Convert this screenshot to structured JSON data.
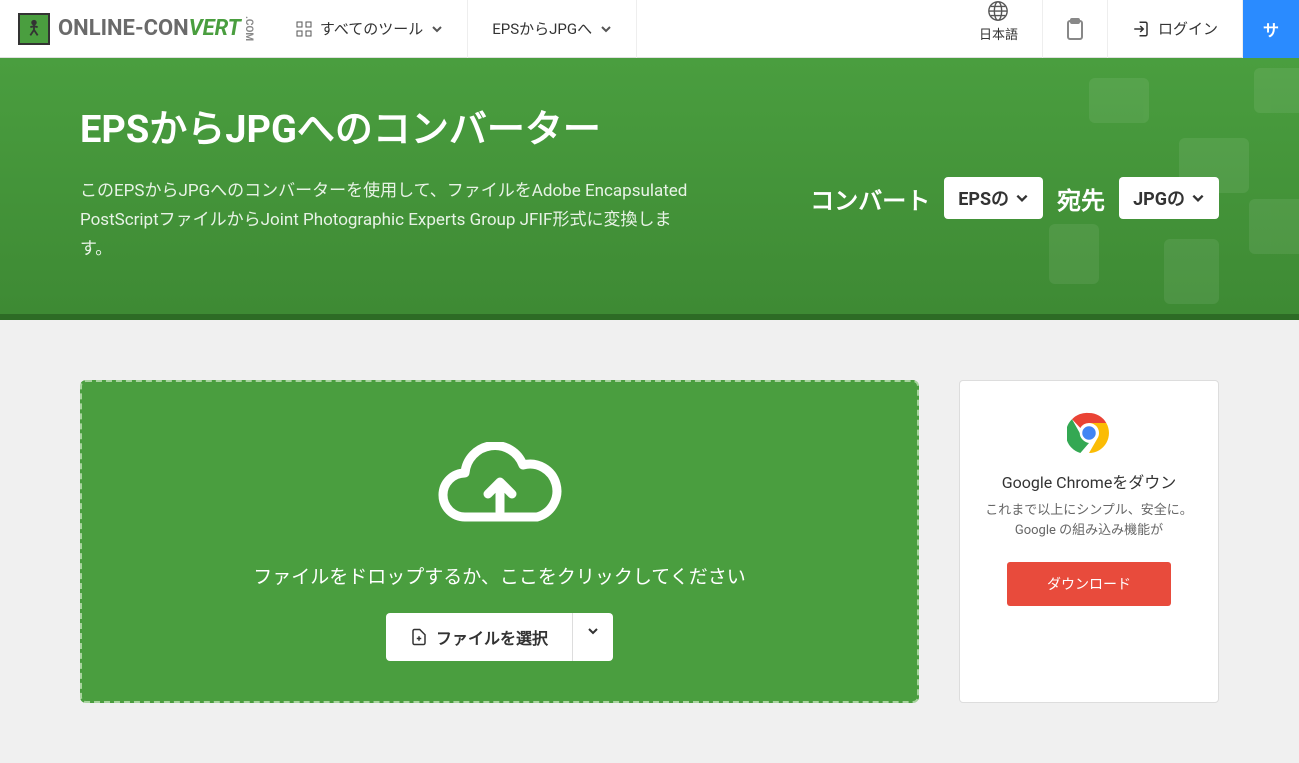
{
  "logo": {
    "part1": "ONLINE",
    "part2": "-CON",
    "part3": "VERT",
    "suffix": ".COM"
  },
  "nav": {
    "all_tools": "すべてのツール",
    "conversion": "EPSからJPGへ",
    "language": "日本語",
    "login": "ログイン",
    "signup": "サ"
  },
  "hero": {
    "title": "EPSからJPGへのコンバーター",
    "description": "このEPSからJPGへのコンバーターを使用して、ファイルをAdobe Encapsulated PostScriptファイルからJoint Photographic Experts Group JFIF形式に変換します。",
    "convert_label": "コンバート",
    "from_format": "EPSの",
    "to_label": "宛先",
    "to_format": "JPGの"
  },
  "dropzone": {
    "text": "ファイルをドロップするか、ここをクリックしてください",
    "button": "ファイルを選択"
  },
  "ad": {
    "title": "Google Chromeをダウン",
    "subtitle": "これまで以上にシンプル、安全に。Google の組み込み機能が",
    "button": "ダウンロード"
  }
}
